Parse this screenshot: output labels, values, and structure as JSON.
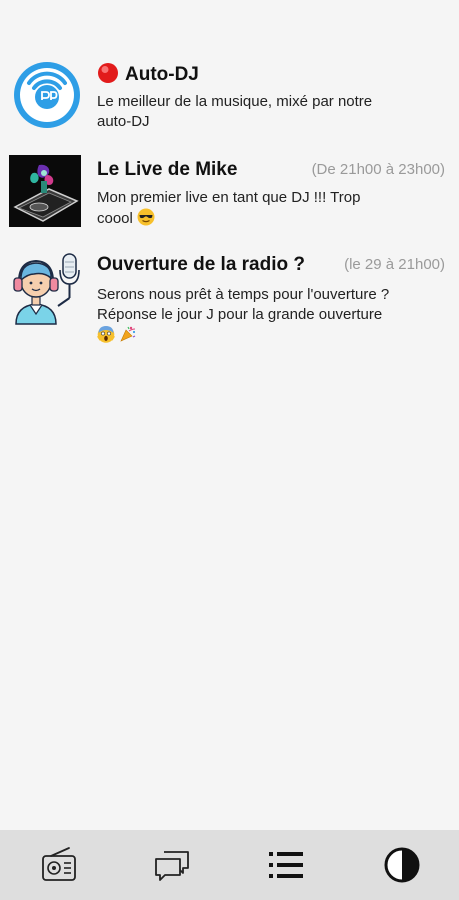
{
  "items": [
    {
      "title": "Auto-DJ",
      "time": "",
      "desc_line1": "Le meilleur de la musique, mixé par notre",
      "desc_line2": "auto-DJ",
      "live_indicator": "red-circle",
      "thumbnail": "radio-logo"
    },
    {
      "title": "Le Live de Mike",
      "time": "(De 21h00 à 23h00)",
      "desc_line1": "Mon premier live en tant que DJ !!! Trop",
      "desc_line2": "coool",
      "emoji": "sunglasses-emoji",
      "thumbnail": "dj-turntable-photo"
    },
    {
      "title": "Ouverture de la radio ?",
      "time": "(le 29 à 21h00)",
      "desc_line1": "Serons nous prêt à temps pour l'ouverture ?",
      "desc_line2": "Réponse le jour J pour la grande ouverture",
      "emoji_line3": [
        "screaming-face-emoji",
        "party-popper-emoji"
      ],
      "thumbnail": "podcaster-illustration"
    }
  ],
  "nav": {
    "items": [
      "radio-icon",
      "chat-icon",
      "list-icon",
      "contrast-icon"
    ],
    "active": "list-icon"
  },
  "colors": {
    "background": "#f5f5f5",
    "nav_background": "#dedede",
    "logo_blue": "#2e9ee6",
    "live_red": "#e21b1b",
    "time_gray": "#9a9a9a"
  }
}
